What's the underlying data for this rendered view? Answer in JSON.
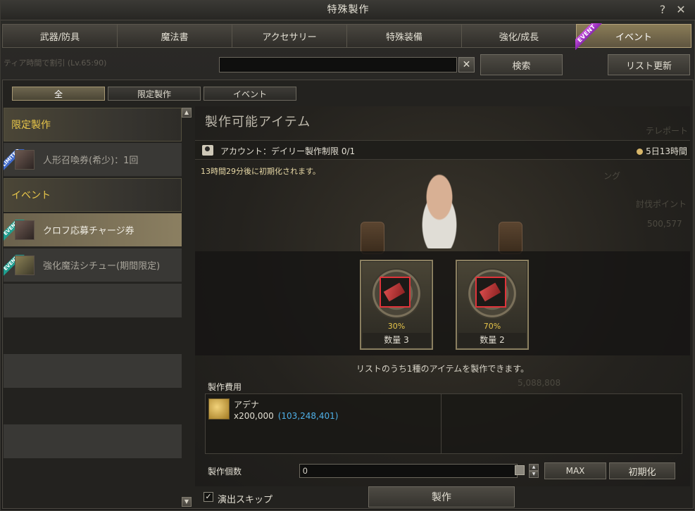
{
  "window": {
    "title": "特殊製作",
    "help_label": "?",
    "close_label": "✕"
  },
  "tabs": [
    {
      "label": "武器/防具"
    },
    {
      "label": "魔法書"
    },
    {
      "label": "アクセサリー"
    },
    {
      "label": "特殊装備"
    },
    {
      "label": "強化/成長"
    },
    {
      "label": "イベント",
      "badge": "EVENT"
    }
  ],
  "search": {
    "value": "",
    "placeholder": "",
    "clear_label": "✕",
    "search_button": "検索",
    "refresh_button": "リスト更新"
  },
  "faded_status": "ティア時間で割引 (Lv.65:90)",
  "filters": [
    {
      "label": "全"
    },
    {
      "label": "限定製作"
    },
    {
      "label": "イベント"
    }
  ],
  "sidebar": {
    "categories": [
      {
        "label": "限定製作"
      },
      {
        "label": "イベント"
      }
    ],
    "items": [
      {
        "label": "人形召喚券(希少)：1回",
        "tag": "LIMITED"
      },
      {
        "label": "クロフ応募チャージ券",
        "tag": "EVENT"
      },
      {
        "label": "強化魔法シチュー(期間限定)",
        "tag": "EVENT"
      }
    ]
  },
  "content": {
    "title": "製作可能アイテム",
    "limit_label": "アカウント：デイリー製作制限 0/1",
    "time_left": "5日13時間",
    "reset_note": "13時間29分後に初期化されます。",
    "ghost_texts": [
      "テレポート",
      "討伐ポイント",
      "500,577",
      "5,088,808",
      "ング"
    ],
    "rewards": [
      {
        "percent": "30%",
        "quantity": "数量 3"
      },
      {
        "percent": "70%",
        "quantity": "数量 2"
      }
    ],
    "choose_note": "リストのうち1種のアイテムを製作できます。",
    "cost_title": "製作費用",
    "cost_item": {
      "name": "アデナ",
      "amount": "x200,000",
      "owned": "(103,248,401)"
    },
    "quantity_label": "製作個数",
    "quantity_value": "0",
    "max_button": "MAX",
    "reset_button": "初期化",
    "skip_label": "演出スキップ",
    "craft_button": "製作"
  },
  "colors": {
    "accent_gold": "#e8c64a",
    "owned_blue": "#4fb0e8",
    "event_purple": "#b13ee0"
  }
}
